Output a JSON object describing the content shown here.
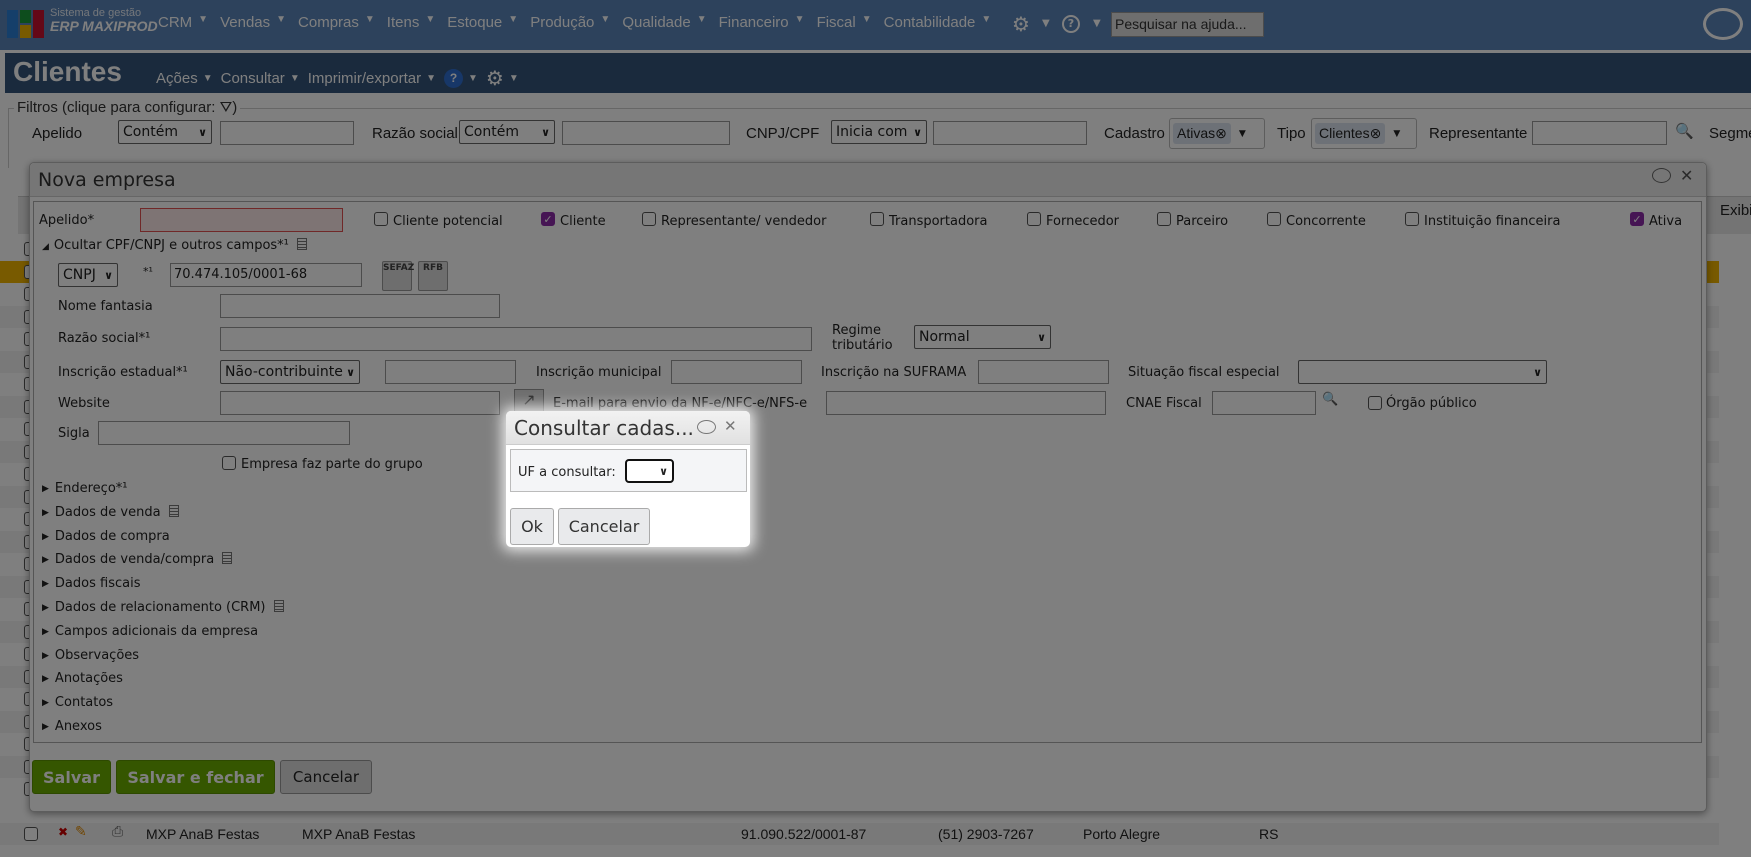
{
  "topbar": {
    "brand_small": "Sistema de gestão",
    "brand_big": "ERP MAXIPROD",
    "menu": [
      "CRM",
      "Vendas",
      "Compras",
      "Itens",
      "Estoque",
      "Produção",
      "Qualidade",
      "Financeiro",
      "Fiscal",
      "Contabilidade"
    ],
    "search_placeholder": "Pesquisar na ajuda..."
  },
  "header": {
    "title": "Clientes",
    "menu": [
      "Ações",
      "Consultar",
      "Imprimir/exportar"
    ]
  },
  "filters": {
    "legend": "Filtros (clique para configurar:",
    "legend_end": ")",
    "apelido": "Apelido",
    "apelido_op": "Contém",
    "razao": "Razão social",
    "razao_op": "Contém",
    "cnpj": "CNPJ/CPF",
    "cnpj_op": "Inicia com",
    "cadastro": "Cadastro",
    "cadastro_chip": "Ativas",
    "tipo": "Tipo",
    "tipo_chip": "Clientes",
    "representante": "Representante",
    "segmento": "Segme"
  },
  "table": {
    "exibir": "Exibi",
    "row": {
      "apelido": "MXP AnaB Festas",
      "razao": "MXP AnaB Festas",
      "cnpj": "91.090.522/0001-87",
      "fone": "(51) 2903-7267",
      "cidade": "Porto Alegre",
      "uf": "RS"
    }
  },
  "dialog": {
    "title": "Nova empresa",
    "apelido_label": "Apelido*",
    "checkboxes": [
      {
        "label": "Cliente potencial",
        "checked": false
      },
      {
        "label": "Cliente",
        "checked": true
      },
      {
        "label": "Representante/ vendedor",
        "checked": false
      },
      {
        "label": "Transportadora",
        "checked": false
      },
      {
        "label": "Fornecedor",
        "checked": false
      },
      {
        "label": "Parceiro",
        "checked": false
      },
      {
        "label": "Concorrente",
        "checked": false
      },
      {
        "label": "Instituição financeira",
        "checked": false
      },
      {
        "label": "Ativa",
        "checked": true
      }
    ],
    "toggle_section": "Ocultar CPF/CNPJ e outros campos*¹",
    "doc_type": "CNPJ",
    "req_mark": "*¹",
    "cnpj_value": "70.474.105/0001-68",
    "sefaz_label": "SEFAZ",
    "rfb_label": "RFB",
    "nome_fantasia": "Nome fantasia",
    "razao_social": "Razão social*¹",
    "regime_label": "Regime tributário",
    "regime_value": "Normal",
    "insc_estadual": "Inscrição estadual*¹",
    "insc_estadual_value": "Não-contribuinte",
    "insc_municipal": "Inscrição municipal",
    "insc_suframa": "Inscrição na SUFRAMA",
    "situacao_fiscal": "Situação fiscal especial",
    "website": "Website",
    "email_nfe": "E-mail para envio da NF-e/NFC-e/NFS-e",
    "cnae": "CNAE Fiscal",
    "orgao_publico": "Órgão público",
    "sigla": "Sigla",
    "grupo": "Empresa faz parte do grupo",
    "sections": [
      {
        "label": "Endereço*¹",
        "doc": false
      },
      {
        "label": "Dados de venda",
        "doc": true
      },
      {
        "label": "Dados de compra",
        "doc": false
      },
      {
        "label": "Dados de venda/compra",
        "doc": true
      },
      {
        "label": "Dados fiscais",
        "doc": false
      },
      {
        "label": "Dados de relacionamento (CRM)",
        "doc": true
      },
      {
        "label": "Campos adicionais da empresa",
        "doc": false
      },
      {
        "label": "Observações",
        "doc": false
      },
      {
        "label": "Anotações",
        "doc": false
      },
      {
        "label": "Contatos",
        "doc": false
      },
      {
        "label": "Anexos",
        "doc": false
      }
    ],
    "save": "Salvar",
    "save_close": "Salvar e fechar",
    "cancel": "Cancelar"
  },
  "modal": {
    "title": "Consultar cadas...",
    "uf_label": "UF a consultar:",
    "uf_value": "",
    "ok": "Ok",
    "cancel": "Cancelar"
  },
  "colors": {
    "topbar": "#5b84b8",
    "header": "#34557a",
    "green": "#6aac00",
    "check": "#8c2aa8",
    "highlight": "#f0b400"
  }
}
